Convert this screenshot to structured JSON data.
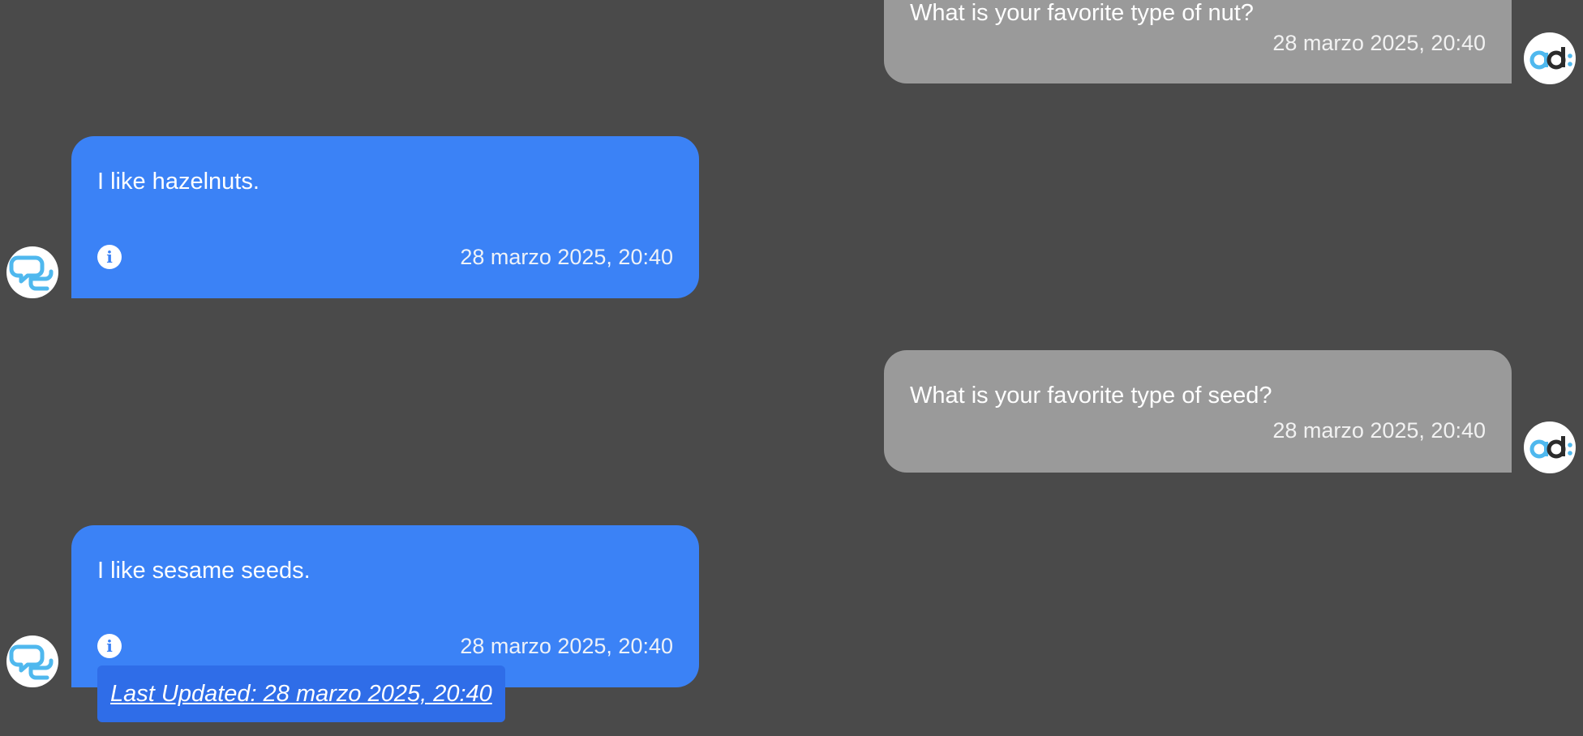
{
  "colors": {
    "background": "#4a4a4a",
    "user_bubble": "#9a9a9a",
    "bot_bubble": "#3b82f6",
    "tooltip": "#2f6de8",
    "avatar_accent": "#4fb8ee"
  },
  "messages": [
    {
      "role": "user",
      "text": "What is your favorite type of nut?",
      "timestamp": "28 marzo 2025, 20:40",
      "avatar_icon": "ad-logo-icon"
    },
    {
      "role": "assistant",
      "text": "I like hazelnuts.",
      "timestamp": "28 marzo 2025, 20:40",
      "info_icon": "info-icon",
      "avatar_icon": "chat-bubbles-logo-icon"
    },
    {
      "role": "user",
      "text": "What is your favorite type of seed?",
      "timestamp": "28 marzo 2025, 20:40",
      "avatar_icon": "ad-logo-icon"
    },
    {
      "role": "assistant",
      "text": "I like sesame seeds.",
      "timestamp": "28 marzo 2025, 20:40",
      "info_icon": "info-icon",
      "avatar_icon": "chat-bubbles-logo-icon"
    }
  ],
  "info_tooltip": {
    "text": "Last Updated: 28 marzo 2025, 20:40"
  },
  "user_avatar": {
    "logo_text_a": "a",
    "logo_text_d": "d"
  }
}
